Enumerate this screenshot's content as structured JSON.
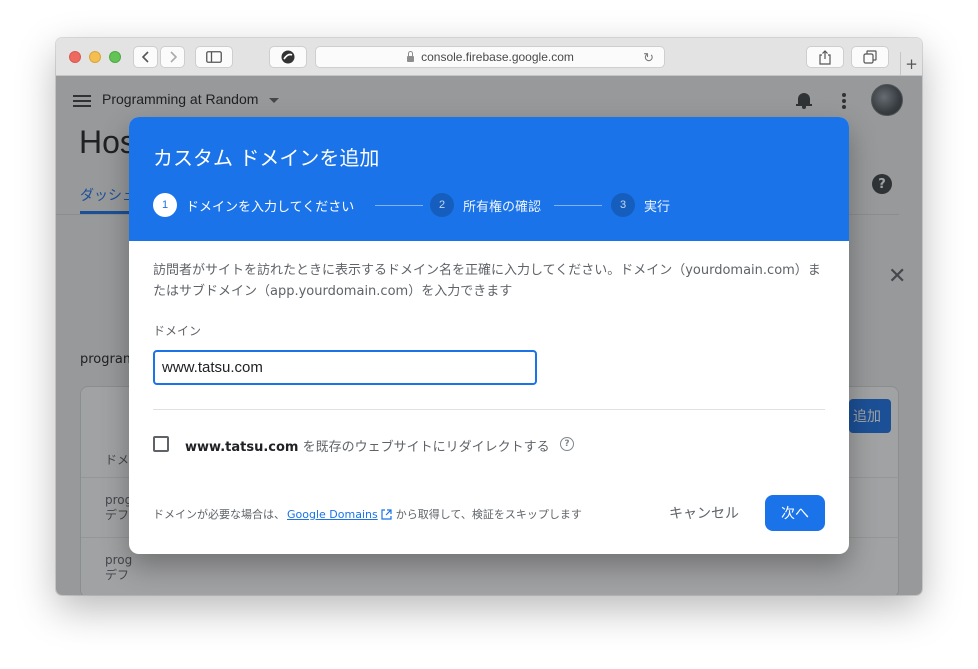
{
  "browser": {
    "url": "console.firebase.google.com",
    "new_tab_label": "+"
  },
  "app": {
    "project_name": "Programming at Random",
    "page_title": "Hos",
    "help_label": "?",
    "active_tab": "ダッシュ",
    "close_label": "✕",
    "project_section_label": "program",
    "add_button_partial": "追加",
    "column_header": "ドメ",
    "rows": [
      {
        "line1": "prog",
        "line2": "デフ"
      },
      {
        "line1": "prog",
        "line2": "デフ"
      }
    ]
  },
  "dialog": {
    "title": "カスタム ドメインを追加",
    "steps": [
      {
        "number": "1",
        "label": "ドメインを入力してください",
        "state": "active"
      },
      {
        "number": "2",
        "label": "所有権の確認",
        "state": "inactive"
      },
      {
        "number": "3",
        "label": "実行",
        "state": "inactive"
      }
    ],
    "description": "訪問者がサイトを訪れたときに表示するドメイン名を正確に入力してください。ドメイン（yourdomain.com）またはサブドメイン（app.yourdomain.com）を入力できます",
    "domain_label": "ドメイン",
    "domain_value": "www.tatsu.com",
    "redirect_domain": "www.tatsu.com",
    "redirect_text": " を既存のウェブサイトにリダイレクトする",
    "redirect_checked": false,
    "footer_prefix": "ドメインが必要な場合は、",
    "footer_link": "Google Domains",
    "footer_suffix": "から取得して、検証をスキップします",
    "cancel_label": "キャンセル",
    "next_label": "次へ"
  },
  "colors": {
    "primary": "#1a73e8",
    "overlay": "rgba(32,33,36,0.42)"
  }
}
